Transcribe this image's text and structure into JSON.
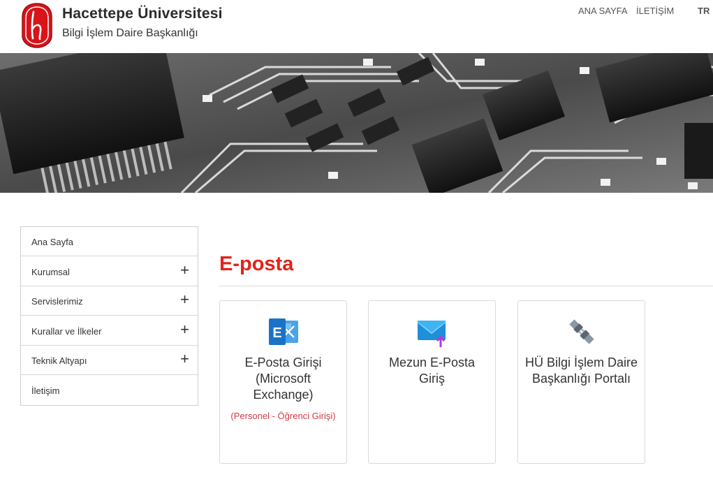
{
  "header": {
    "title": "Hacettepe Üniversitesi",
    "subtitle": "Bilgi İşlem Daire Başkanlığı",
    "logo_icon": "hacettepe-logo-icon",
    "nav": {
      "home": "ANA SAYFA",
      "contact": "İLETİŞİM",
      "lang": "TR"
    }
  },
  "banner": {
    "image": "circuit-board-banner"
  },
  "sidebar": {
    "items": [
      {
        "label": "Ana Sayfa",
        "expandable": false
      },
      {
        "label": "Kurumsal",
        "expandable": true
      },
      {
        "label": "Servislerimiz",
        "expandable": true
      },
      {
        "label": "Kurallar ve İlkeler",
        "expandable": true
      },
      {
        "label": "Teknik Altyapı",
        "expandable": true
      },
      {
        "label": "İletişim",
        "expandable": false
      }
    ],
    "expand_glyph": "+"
  },
  "main": {
    "title": "E-posta",
    "cards": [
      {
        "icon": "exchange-icon",
        "title": "E-Posta Girişi (Microsoft Exchange)",
        "subtitle": "(Personel - Öğrenci Girişi)"
      },
      {
        "icon": "mail-upload-icon",
        "title": "Mezun E-Posta Giriş",
        "subtitle": ""
      },
      {
        "icon": "plug-icon",
        "title": "HÜ Bilgi İşlem Daire Başkanlığı Portalı",
        "subtitle": ""
      }
    ]
  },
  "colors": {
    "accent_red": "#e2231a",
    "subtitle_red": "#d23a44",
    "exchange_blue": "#1a73c8"
  }
}
